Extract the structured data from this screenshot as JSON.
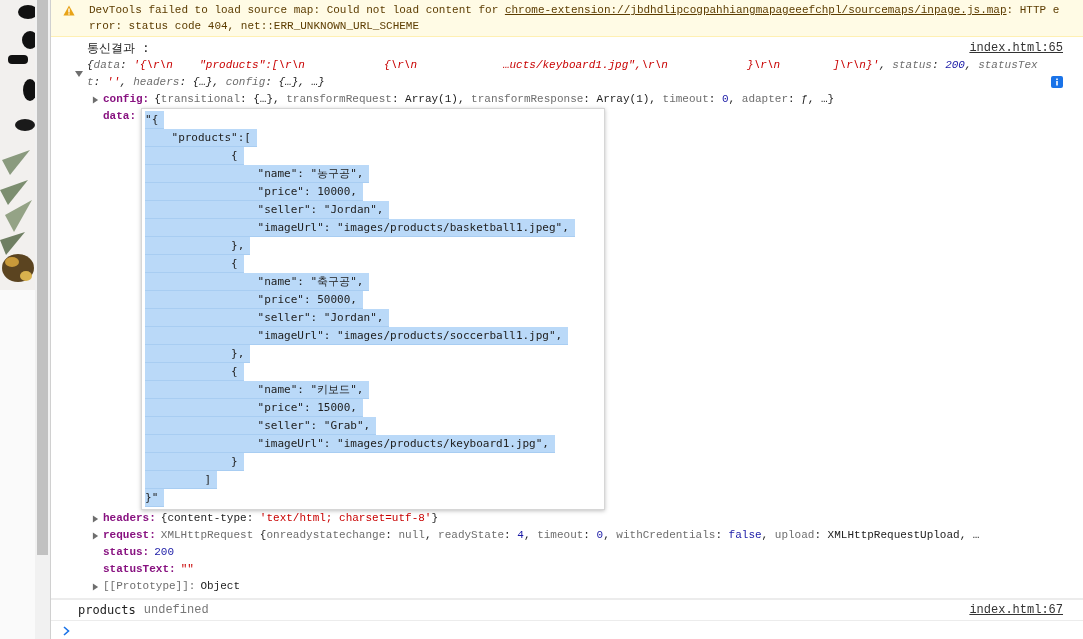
{
  "warning": {
    "text_before": "DevTools failed to load source map: Could not load content for ",
    "link": "chrome-extension://jbdhdlipcogpahhiangmapageeefchpl/sourcemaps/inpage.js.map",
    "text_after": ": HTTP error: status code 404, net::ERR_UNKNOWN_URL_SCHEME"
  },
  "log": {
    "label": "통신결과 :",
    "source": "index.html:65",
    "expanded": true,
    "preview": [
      {
        "kind": "punct",
        "text": "{"
      },
      {
        "kind": "key",
        "text": "data"
      },
      {
        "kind": "punct",
        "text": ": "
      },
      {
        "kind": "string",
        "text": "'{\\r\\n    \"products\":[\\r\\n            {\\r\\n             …ucts/keyboard1.jpg\",\\r\\n            }\\r\\n        ]\\r\\n}'"
      },
      {
        "kind": "punct",
        "text": ", "
      },
      {
        "kind": "key",
        "text": "status"
      },
      {
        "kind": "punct",
        "text": ": "
      },
      {
        "kind": "number",
        "text": "200"
      },
      {
        "kind": "punct",
        "text": ", "
      },
      {
        "kind": "key",
        "text": "statusText"
      },
      {
        "kind": "punct",
        "text": ": "
      },
      {
        "kind": "string",
        "text": "''"
      },
      {
        "kind": "punct",
        "text": ", "
      },
      {
        "kind": "key",
        "text": "headers"
      },
      {
        "kind": "punct",
        "text": ": {…}, "
      },
      {
        "kind": "key",
        "text": "config"
      },
      {
        "kind": "punct",
        "text": ": {…}, …}"
      }
    ],
    "properties": [
      {
        "name": "config:",
        "kind": "value",
        "expandable": true,
        "own": true,
        "value": [
          {
            "kind": "punct",
            "text": "{"
          },
          {
            "kind": "key",
            "text": "transitional"
          },
          {
            "kind": "punct",
            "text": ": {…}, "
          },
          {
            "kind": "key",
            "text": "transformRequest"
          },
          {
            "kind": "punct",
            "text": ": Array(1), "
          },
          {
            "kind": "key",
            "text": "transformResponse"
          },
          {
            "kind": "punct",
            "text": ": Array(1), "
          },
          {
            "kind": "key",
            "text": "timeout"
          },
          {
            "kind": "punct",
            "text": ": "
          },
          {
            "kind": "number",
            "text": "0"
          },
          {
            "kind": "punct",
            "text": ", "
          },
          {
            "kind": "key",
            "text": "adapter"
          },
          {
            "kind": "punct",
            "text": ": "
          },
          {
            "kind": "func",
            "text": "ƒ"
          },
          {
            "kind": "punct",
            "text": ", …}"
          }
        ]
      },
      {
        "name": "data:",
        "kind": "popup",
        "expandable": false,
        "own": true,
        "selected": true,
        "lines": [
          "\"{",
          "    \"products\":[",
          "             {",
          "                 \"name\": \"농구공\",",
          "                 \"price\": 10000,",
          "                 \"seller\": \"Jordan\",",
          "                 \"imageUrl\": \"images/products/basketball1.jpeg\",",
          "             },",
          "             {",
          "                 \"name\": \"축구공\",",
          "                 \"price\": 50000,",
          "                 \"seller\": \"Jordan\",",
          "                 \"imageUrl\": \"images/products/soccerball1.jpg\",",
          "             },",
          "             {",
          "                 \"name\": \"키보드\",",
          "                 \"price\": 15000,",
          "                 \"seller\": \"Grab\",",
          "                 \"imageUrl\": \"images/products/keyboard1.jpg\",",
          "             }",
          "         ]",
          "}\""
        ]
      },
      {
        "name": "headers:",
        "kind": "value",
        "expandable": true,
        "own": true,
        "value": [
          {
            "kind": "punct",
            "text": "{"
          },
          {
            "kind": "text",
            "text": "content-type"
          },
          {
            "kind": "punct",
            "text": ": "
          },
          {
            "kind": "string",
            "text": "'text/html; charset=utf-8'"
          },
          {
            "kind": "punct",
            "text": "}"
          }
        ]
      },
      {
        "name": "request:",
        "kind": "value",
        "expandable": true,
        "own": true,
        "value": [
          {
            "kind": "key",
            "text": "XMLHttpRequest "
          },
          {
            "kind": "punct",
            "text": "{"
          },
          {
            "kind": "key",
            "text": "onreadystatechange"
          },
          {
            "kind": "punct",
            "text": ": "
          },
          {
            "kind": "key",
            "text": "null"
          },
          {
            "kind": "punct",
            "text": ", "
          },
          {
            "kind": "key",
            "text": "readyState"
          },
          {
            "kind": "punct",
            "text": ": "
          },
          {
            "kind": "number",
            "text": "4"
          },
          {
            "kind": "punct",
            "text": ", "
          },
          {
            "kind": "key",
            "text": "timeout"
          },
          {
            "kind": "punct",
            "text": ": "
          },
          {
            "kind": "number",
            "text": "0"
          },
          {
            "kind": "punct",
            "text": ", "
          },
          {
            "kind": "key",
            "text": "withCredentials"
          },
          {
            "kind": "punct",
            "text": ": "
          },
          {
            "kind": "number",
            "text": "false"
          },
          {
            "kind": "punct",
            "text": ", "
          },
          {
            "kind": "key",
            "text": "upload"
          },
          {
            "kind": "punct",
            "text": ": XMLHttpRequestUpload, …"
          }
        ]
      },
      {
        "name": "status:",
        "kind": "value",
        "expandable": false,
        "own": true,
        "value": [
          {
            "kind": "number",
            "text": "200"
          }
        ]
      },
      {
        "name": "statusText:",
        "kind": "value",
        "expandable": false,
        "own": true,
        "value": [
          {
            "kind": "string",
            "text": "\"\""
          }
        ]
      },
      {
        "name": "[[Prototype]]:",
        "kind": "value",
        "expandable": true,
        "own": false,
        "value": [
          {
            "kind": "text",
            "text": "Object"
          }
        ]
      }
    ]
  },
  "log2": {
    "label": "products",
    "value": "undefined",
    "source": "index.html:67"
  }
}
